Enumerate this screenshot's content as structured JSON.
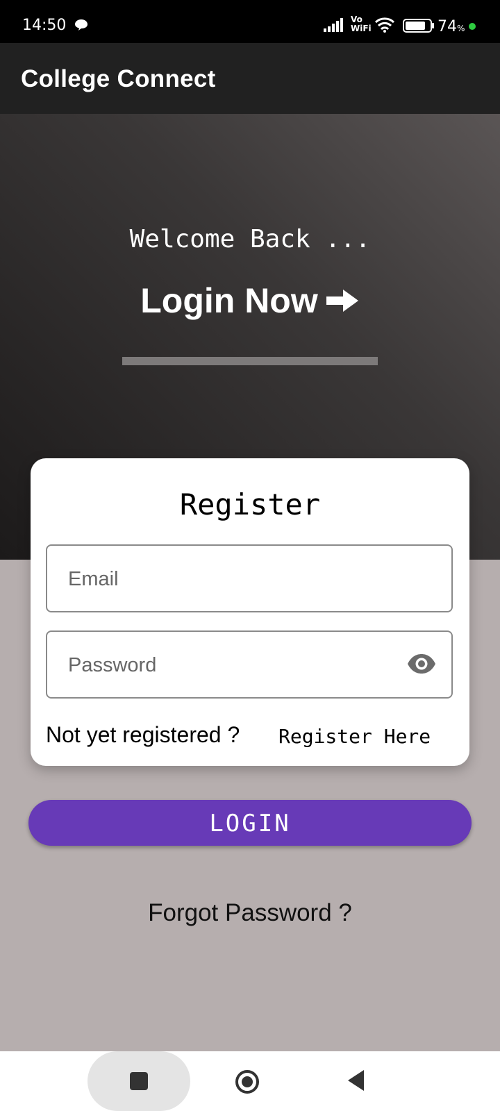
{
  "status_bar": {
    "time": "14:50",
    "vowifi_top": "Vo",
    "vowifi_bottom": "WiFi",
    "battery_percent": "74",
    "battery_unit": "%",
    "icons": [
      "chat-bubble-icon",
      "signal-icon",
      "wifi-icon",
      "battery-icon"
    ]
  },
  "app_bar": {
    "title": "College Connect"
  },
  "hero": {
    "welcome": "Welcome Back ...",
    "login_now": "Login Now"
  },
  "card": {
    "heading": "Register",
    "email_placeholder": "Email",
    "password_placeholder": "Password",
    "not_registered": "Not yet registered ?",
    "register_here": "Register Here"
  },
  "actions": {
    "login_label": "LOGIN",
    "forgot_password": "Forgot Password ?"
  },
  "colors": {
    "accent": "#673ab7",
    "app_bar": "#212121",
    "background": "#b6aeae"
  }
}
